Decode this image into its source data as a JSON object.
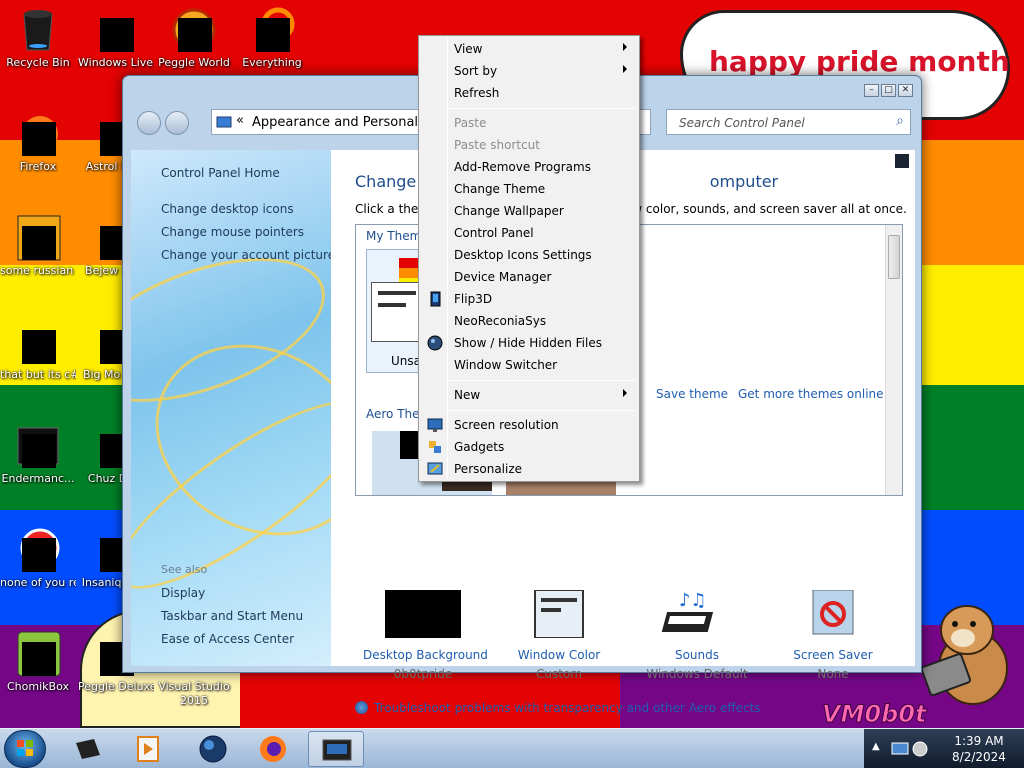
{
  "desktop": {
    "bubble_text": "happy pride month",
    "watermark": "VM0b0t",
    "icons": [
      {
        "label": "Recycle Bin"
      },
      {
        "label": "Windows Live Mail"
      },
      {
        "label": "Peggle World"
      },
      {
        "label": "Everything"
      },
      {
        "label": "Firefox"
      },
      {
        "label": "Astrol Delu"
      },
      {
        "label": "some russian ran a rat"
      },
      {
        "label": "Bejew Delu"
      },
      {
        "label": "that but its c#"
      },
      {
        "label": "Big Mo Delu"
      },
      {
        "label": "Endermanc..."
      },
      {
        "label": "Chuz Delu"
      },
      {
        "label": "none of you retards kno..."
      },
      {
        "label": "Insaniq Delu"
      },
      {
        "label": "ChomikBox"
      },
      {
        "label": "Peggle Deluxe"
      },
      {
        "label": "Visual Studio 2015"
      }
    ]
  },
  "window": {
    "breadcrumb": "Appearance and Personaliza",
    "search_placeholder": "Search Control Panel",
    "left_links": [
      "Control Panel Home",
      "Change desktop icons",
      "Change mouse pointers",
      "Change your account picture"
    ],
    "see_also_label": "See also",
    "see_also_links": [
      "Display",
      "Taskbar and Start Menu",
      "Ease of Access Center"
    ],
    "title": "Change th",
    "title_tail": "omputer",
    "subtitle": "Click a theme",
    "subtitle_tail": "dow color, sounds, and screen saver all at once.",
    "my_themes_label": "My Theme",
    "unsaved_label": "Unsav",
    "aero_label": "Aero Them",
    "save_theme": "Save theme",
    "get_more": "Get more themes online",
    "options": [
      {
        "name": "Desktop Background",
        "value": "0b0tpride"
      },
      {
        "name": "Window Color",
        "value": "Custom"
      },
      {
        "name": "Sounds",
        "value": "Windows Default"
      },
      {
        "name": "Screen Saver",
        "value": "None"
      }
    ],
    "troubleshoot": "Troubleshoot problems with transparency and other Aero effects"
  },
  "context_menu": {
    "items": [
      {
        "label": "View",
        "submenu": true
      },
      {
        "label": "Sort by",
        "submenu": true
      },
      {
        "label": "Refresh"
      },
      {
        "label": "Paste",
        "disabled": true
      },
      {
        "label": "Paste shortcut",
        "disabled": true
      },
      {
        "label": "Add-Remove Programs"
      },
      {
        "label": "Change Theme"
      },
      {
        "label": "Change Wallpaper"
      },
      {
        "label": "Control Panel"
      },
      {
        "label": "Desktop Icons Settings"
      },
      {
        "label": "Device Manager"
      },
      {
        "label": "Flip3D"
      },
      {
        "label": "NeoReconiaSys"
      },
      {
        "label": "Show / Hide Hidden Files"
      },
      {
        "label": "Window Switcher"
      },
      {
        "label": "New",
        "submenu": true
      },
      {
        "label": "Screen resolution"
      },
      {
        "label": "Gadgets"
      },
      {
        "label": "Personalize"
      }
    ]
  },
  "taskbar": {
    "time": "1:39 AM",
    "date": "8/2/2024"
  }
}
